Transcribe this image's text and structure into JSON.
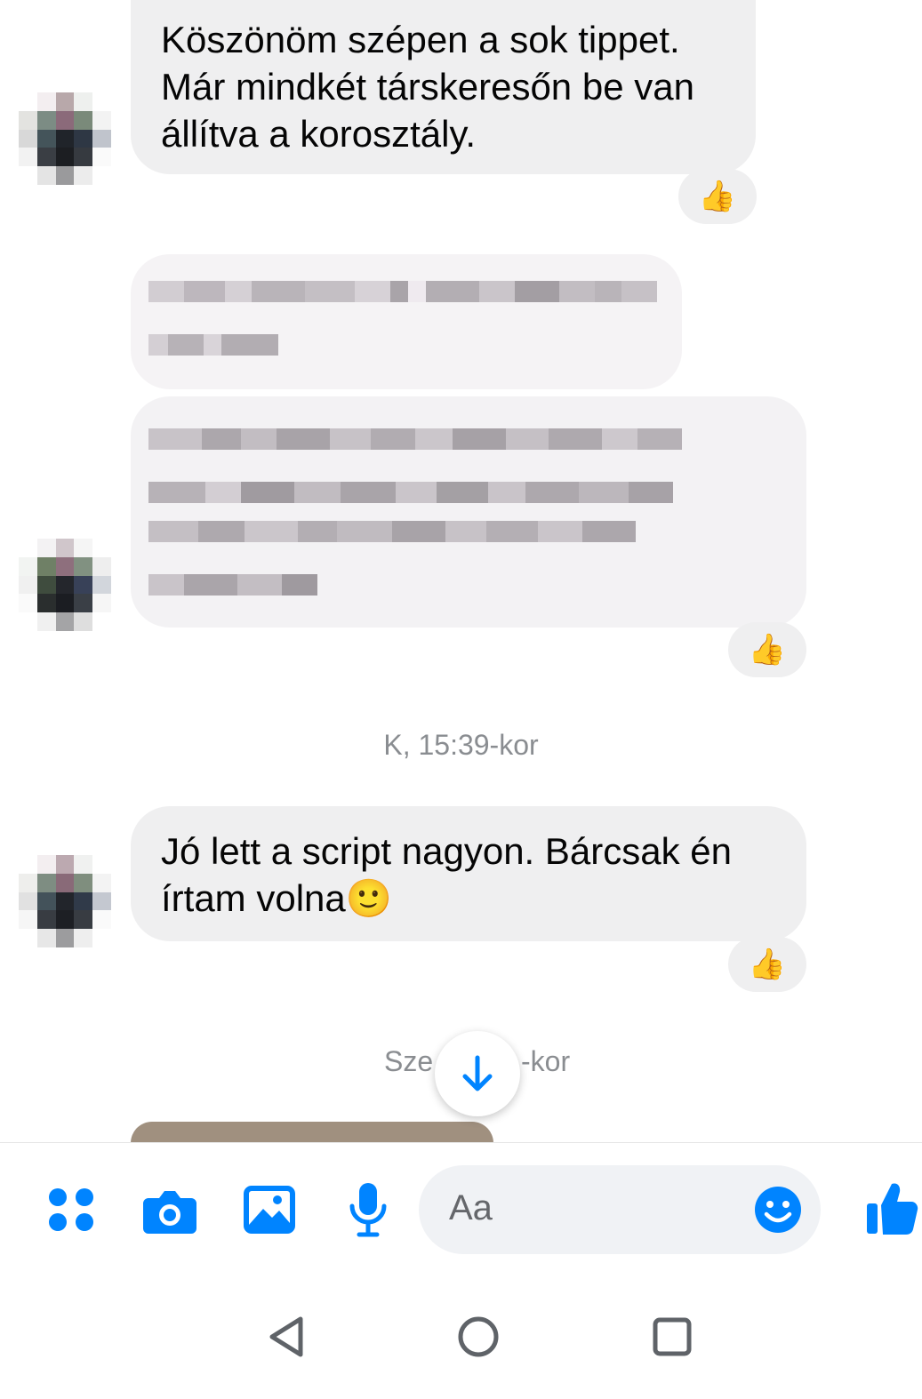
{
  "messages": [
    {
      "text": "Köszönöm szépen a sok tippet.\nMár mindkét társkeresőn be van\nállítva a korosztály.",
      "reaction": "👍"
    },
    {
      "text": "",
      "reaction": ""
    },
    {
      "text": "",
      "reaction": "👍"
    },
    {
      "text": "Jó lett a script nagyon. Bárcsak én\nírtam volna🙂",
      "reaction": "👍"
    }
  ],
  "timestamps": {
    "first": "K, 15:39-kor",
    "second_left": "Sze",
    "second_right": "-kor"
  },
  "composer": {
    "placeholder": "Aa",
    "icons": [
      "apps-icon",
      "camera-icon",
      "image-icon",
      "microphone-icon",
      "emoji-icon",
      "thumbs-up-icon"
    ]
  },
  "colors": {
    "accent": "#0084ff",
    "bubble": "#efeff0",
    "timestamp": "#8a8d91"
  }
}
